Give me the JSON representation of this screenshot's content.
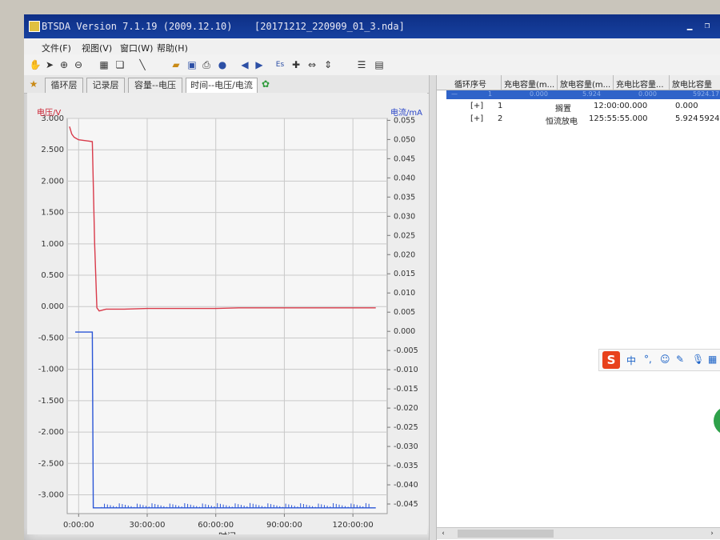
{
  "window": {
    "app_title": "BTSDA Version 7.1.19 (2009.12.10)",
    "file_title": "[20171212_220909_01_3.nda]"
  },
  "menu": [
    "文件(F)",
    "视图(V)",
    "窗口(W)",
    "帮助(H)"
  ],
  "toolbar": {
    "zoom_label": "Es"
  },
  "tabs": [
    {
      "label": "循环层",
      "active": false
    },
    {
      "label": "记录层",
      "active": false
    },
    {
      "label": "容量--电压",
      "active": false
    },
    {
      "label": "时间--电压/电流",
      "active": true
    }
  ],
  "grid": {
    "columns": [
      "循环序号",
      "充电容量(m...",
      "放电容量(m...",
      "充电比容量...",
      "放电比容量"
    ],
    "selected_row": [
      "—",
      "1",
      "0.000",
      "5.924",
      "0.000",
      "5924.17"
    ],
    "rows": [
      {
        "expander": "[+]",
        "index": "1",
        "step": "搁置",
        "time": "12:00:00.000",
        "capacity": "0.000",
        "specific": ""
      },
      {
        "expander": "[+]",
        "index": "2",
        "step": "恒流放电",
        "time": "125:55:55.000",
        "capacity": "5.924",
        "specific": "5924"
      }
    ]
  },
  "ime": {
    "chinese": "中",
    "punct": "°,"
  },
  "chart_data": {
    "type": "line",
    "xlabel": "时间",
    "x_ticks": [
      "0:00:00",
      "30:00:00",
      "60:00:00",
      "90:00:00",
      "120:00:00"
    ],
    "x_range_hours": [
      -5,
      135
    ],
    "y_left": {
      "label": "电压/V",
      "range": [
        -3.3,
        3.0
      ],
      "ticks": [
        "3.000",
        "2.500",
        "2.000",
        "1.500",
        "1.000",
        "0.500",
        "0.000",
        "-0.500",
        "-1.000",
        "-1.500",
        "-2.000",
        "-2.500",
        "-3.000"
      ]
    },
    "y_right": {
      "label": "电流/mA",
      "range": [
        -0.0475,
        0.0555
      ],
      "ticks": [
        "0.055",
        "0.050",
        "0.045",
        "0.040",
        "0.035",
        "0.030",
        "0.025",
        "0.020",
        "0.015",
        "0.010",
        "0.005",
        "0.000",
        "-0.005",
        "-0.010",
        "-0.015",
        "-0.020",
        "-0.025",
        "-0.030",
        "-0.035",
        "-0.040",
        "-0.045"
      ]
    },
    "grid": true,
    "series": [
      {
        "name": "电压/V",
        "axis": "left",
        "color": "#d93a4a",
        "x": [
          -4,
          -3,
          -2,
          -1,
          0,
          2,
          4,
          6,
          7,
          8,
          9,
          12,
          20,
          30,
          40,
          50,
          60,
          70,
          80,
          90,
          100,
          110,
          120,
          130
        ],
        "y": [
          2.87,
          2.75,
          2.7,
          2.68,
          2.66,
          2.65,
          2.64,
          2.63,
          1.0,
          -0.02,
          -0.07,
          -0.04,
          -0.04,
          -0.03,
          -0.03,
          -0.03,
          -0.03,
          -0.02,
          -0.02,
          -0.02,
          -0.02,
          -0.02,
          -0.02,
          -0.02
        ]
      },
      {
        "name": "电流/mA",
        "axis": "right",
        "color": "#2a55d6",
        "x": [
          -1.5,
          0,
          4,
          6,
          6.4,
          7,
          8,
          20,
          40,
          60,
          80,
          100,
          120,
          130
        ],
        "y": [
          -0.0002,
          -0.0002,
          -0.0002,
          -0.0002,
          -0.046,
          -0.046,
          -0.046,
          -0.046,
          -0.046,
          -0.046,
          -0.046,
          -0.046,
          -0.046,
          -0.046
        ]
      }
    ]
  }
}
